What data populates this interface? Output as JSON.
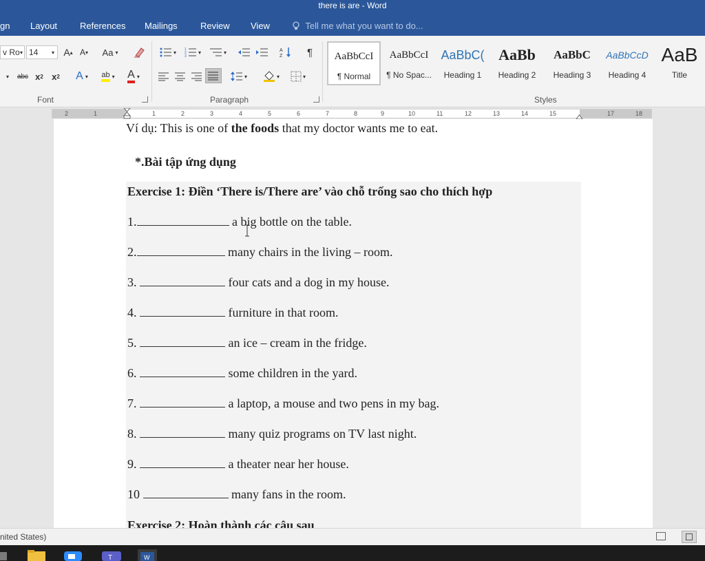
{
  "window": {
    "title": "there is are - Word"
  },
  "tabs": [
    "gn",
    "Layout",
    "References",
    "Mailings",
    "Review",
    "View"
  ],
  "tell_me_placeholder": "Tell me what you want to do...",
  "ribbon": {
    "font": {
      "group_label": "Font",
      "font_name": "v Ro",
      "font_size": "14",
      "grow_label": "A",
      "shrink_label": "A",
      "change_case_label": "Aa",
      "strikethrough_label": "abc",
      "subscript_label": "x",
      "superscript_label": "x",
      "text_effects_label": "A",
      "highlight_label": "ab",
      "font_color_label": "A"
    },
    "paragraph": {
      "group_label": "Paragraph"
    },
    "styles": {
      "group_label": "Styles",
      "items": [
        {
          "sample": "AaBbCcI",
          "name": "¶ Normal"
        },
        {
          "sample": "AaBbCcI",
          "name": "¶ No Spac..."
        },
        {
          "sample": "AaBbC(",
          "name": "Heading 1"
        },
        {
          "sample": "AaBb",
          "name": "Heading 2"
        },
        {
          "sample": "AaBbC",
          "name": "Heading 3"
        },
        {
          "sample": "AaBbCcD",
          "name": "Heading 4"
        },
        {
          "sample": "AaB",
          "name": "Title"
        }
      ]
    }
  },
  "ruler": {
    "ticks": [
      "2",
      "1",
      "1",
      "2",
      "3",
      "4",
      "5",
      "6",
      "7",
      "8",
      "9",
      "10",
      "11",
      "12",
      "13",
      "14",
      "15",
      "17",
      "18"
    ]
  },
  "document": {
    "example_prefix": "Ví dụ: This is one of ",
    "example_bold": "the foods",
    "example_suffix": " that my doctor wants me to eat.",
    "section_heading": "*.Bài tập ứng dụng",
    "exercise1_title": "Exercise 1: Điền ‘There is/There are’ vào chỗ trống sao cho thích hợp",
    "items": [
      {
        "num": "1.",
        "text": " a big bottle on the table."
      },
      {
        "num": "2.",
        "text": " many chairs in the living – room."
      },
      {
        "num": "3. ",
        "text": " four cats and a dog in my house."
      },
      {
        "num": "4. ",
        "text": " furniture in that room."
      },
      {
        "num": "5. ",
        "text": " an ice – cream in the fridge."
      },
      {
        "num": "6. ",
        "text": " some children in the yard."
      },
      {
        "num": "7. ",
        "text": " a laptop, a mouse and two pens in my bag."
      },
      {
        "num": "8. ",
        "text": " many quiz programs on TV last night."
      },
      {
        "num": "9. ",
        "text": " a theater near her house."
      },
      {
        "num": "10 ",
        "text": " many fans in the room."
      }
    ],
    "exercise2_title": "Exercise 2: Hoàn thành các câu sau"
  },
  "statusbar": {
    "language": "nited States)"
  }
}
